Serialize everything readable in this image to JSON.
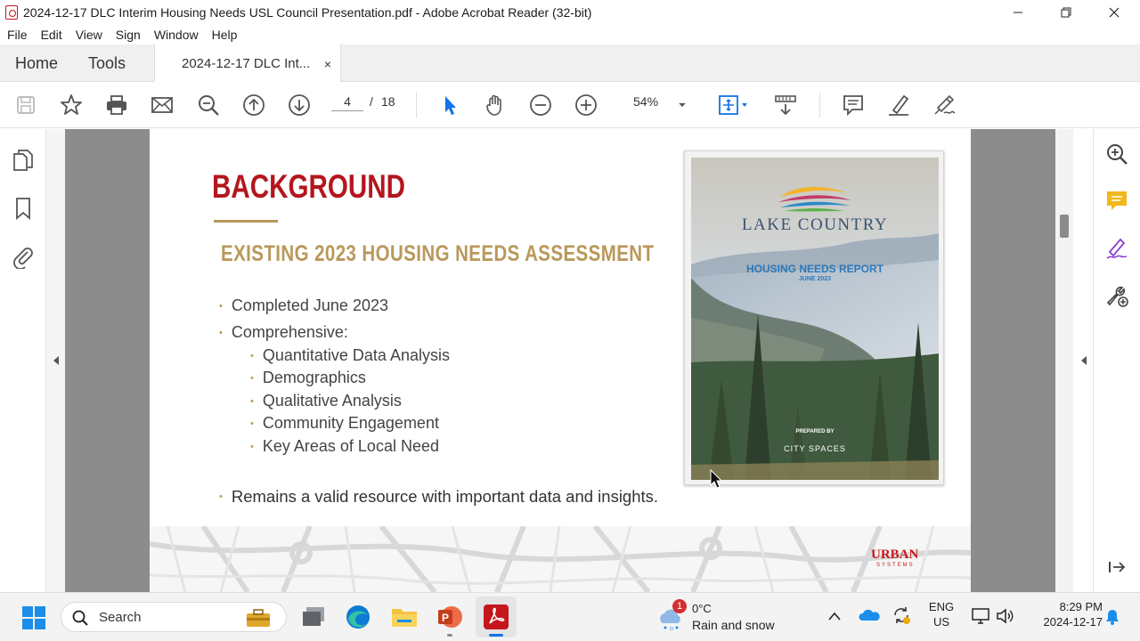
{
  "window": {
    "title": "2024-12-17 DLC Interim Housing Needs USL Council Presentation.pdf - Adobe Acrobat Reader (32-bit)",
    "minimize_icon": "minimize-icon",
    "maximize_icon": "restore-icon",
    "close_icon": "close-icon"
  },
  "menu": [
    "File",
    "Edit",
    "View",
    "Sign",
    "Window",
    "Help"
  ],
  "tabs": {
    "home": "Home",
    "tools": "Tools",
    "document": "2024-12-17 DLC Int...",
    "close": "×"
  },
  "toolbar": {
    "current_page": "4",
    "page_separator": "/",
    "total_pages": "18",
    "zoom": "54%"
  },
  "slide": {
    "title": "BACKGROUND",
    "subtitle": "EXISTING 2023 HOUSING NEEDS ASSESSMENT",
    "bullets": [
      "Completed June 2023",
      "Comprehensive:"
    ],
    "sub_bullets": [
      "Quantitative Data Analysis",
      "Demographics",
      "Qualitative Analysis",
      "Community Engagement",
      "Key Areas of Local Need"
    ],
    "final_bullet": "Remains a valid resource with important data and insights.",
    "bullet_glyph": "•"
  },
  "cover": {
    "brand": "LAKE COUNTRY",
    "report_title": "HOUSING NEEDS REPORT",
    "report_date": "JUNE 2023",
    "prepared_by": "PREPARED BY",
    "firm": "CITY SPACES"
  },
  "footer_logo": {
    "line1": "URBAN",
    "line2": "SYSTEMS"
  },
  "taskbar": {
    "search_label": "Search",
    "weather_temp": "0°C",
    "weather_desc": "Rain and snow",
    "weather_badge": "1",
    "lang": "ENG",
    "region": "US",
    "time": "8:29 PM",
    "date": "2024-12-17"
  },
  "colors": {
    "accent_red": "#b4161e",
    "gold": "#b9985a",
    "acrobat_blue": "#1473e6"
  }
}
